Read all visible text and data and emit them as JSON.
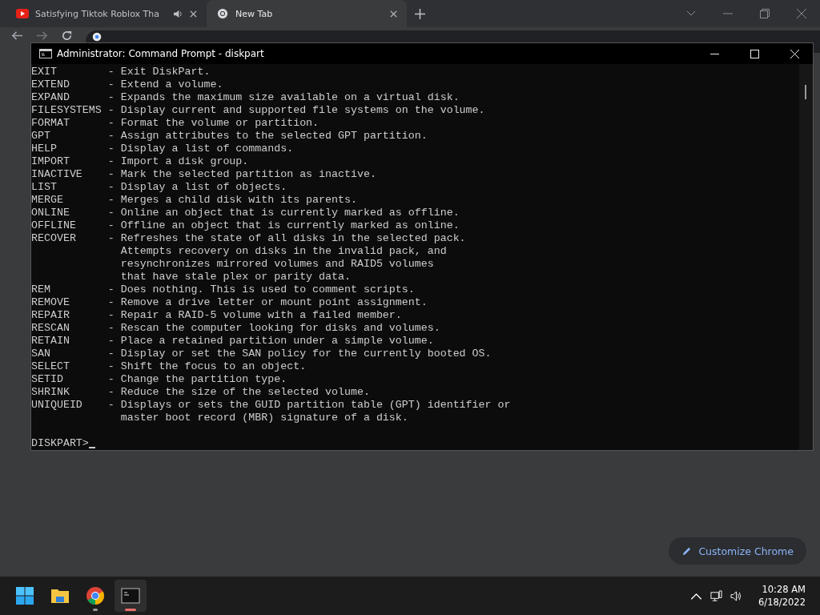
{
  "browser": {
    "tabs": [
      {
        "title": "Satisfying Tiktok Roblox Tha",
        "kind": "video",
        "audio": true,
        "selected": false
      },
      {
        "title": "New Tab",
        "kind": "newtab",
        "audio": false,
        "selected": true
      }
    ],
    "customize_button": "Customize Chrome"
  },
  "console": {
    "title": "Administrator: Command Prompt - diskpart",
    "lines": [
      "EXIT        - Exit DiskPart.",
      "EXTEND      - Extend a volume.",
      "EXPAND      - Expands the maximum size available on a virtual disk.",
      "FILESYSTEMS - Display current and supported file systems on the volume.",
      "FORMAT      - Format the volume or partition.",
      "GPT         - Assign attributes to the selected GPT partition.",
      "HELP        - Display a list of commands.",
      "IMPORT      - Import a disk group.",
      "INACTIVE    - Mark the selected partition as inactive.",
      "LIST        - Display a list of objects.",
      "MERGE       - Merges a child disk with its parents.",
      "ONLINE      - Online an object that is currently marked as offline.",
      "OFFLINE     - Offline an object that is currently marked as online.",
      "RECOVER     - Refreshes the state of all disks in the selected pack.",
      "              Attempts recovery on disks in the invalid pack, and",
      "              resynchronizes mirrored volumes and RAID5 volumes",
      "              that have stale plex or parity data.",
      "REM         - Does nothing. This is used to comment scripts.",
      "REMOVE      - Remove a drive letter or mount point assignment.",
      "REPAIR      - Repair a RAID-5 volume with a failed member.",
      "RESCAN      - Rescan the computer looking for disks and volumes.",
      "RETAIN      - Place a retained partition under a simple volume.",
      "SAN         - Display or set the SAN policy for the currently booted OS.",
      "SELECT      - Shift the focus to an object.",
      "SETID       - Change the partition type.",
      "SHRINK      - Reduce the size of the selected volume.",
      "UNIQUEID    - Displays or sets the GUID partition table (GPT) identifier or",
      "              master boot record (MBR) signature of a disk."
    ],
    "prompt": "DISKPART>"
  },
  "taskbar": {
    "apps": [
      {
        "kind": "start",
        "running": false,
        "active": false
      },
      {
        "kind": "folder",
        "running": false,
        "active": false
      },
      {
        "kind": "chrome",
        "running": true,
        "active": false
      },
      {
        "kind": "terminal",
        "running": true,
        "active": true
      }
    ],
    "time": "10:28 AM",
    "date": "6/18/2022"
  }
}
